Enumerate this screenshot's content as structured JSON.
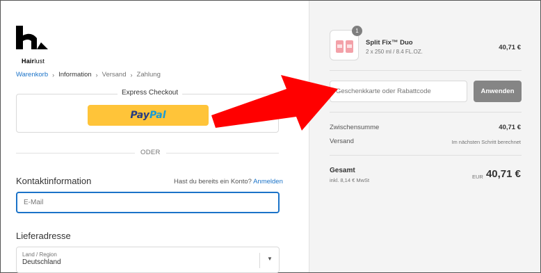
{
  "brand": {
    "logo_bold": "Hair",
    "logo_light": "lust"
  },
  "breadcrumb": [
    {
      "label": "Warenkorb"
    },
    {
      "label": "Information"
    },
    {
      "label": "Versand"
    },
    {
      "label": "Zahlung"
    }
  ],
  "express": {
    "title": "Express Checkout",
    "paypal_pay": "Pay",
    "paypal_pal": "Pal"
  },
  "divider": {
    "label": "ODER"
  },
  "contact": {
    "title": "Kontaktinformation",
    "login_question": "Hast du bereits ein Konto?",
    "login_link": "Anmelden",
    "email_placeholder": "E-Mail"
  },
  "shipping": {
    "title": "Lieferadresse",
    "country_label": "Land / Region",
    "country_value": "Deutschland"
  },
  "summary": {
    "item": {
      "quantity": "1",
      "name": "Split Fix™ Duo",
      "variant": "2 x 250 ml / 8.4 FL.OZ.",
      "price": "40,71 €"
    },
    "discount_placeholder": "Geschenkkarte oder Rabattcode",
    "apply_label": "Anwenden",
    "subtotal_label": "Zwischensumme",
    "subtotal_value": "40,71 €",
    "shipping_label": "Versand",
    "shipping_value": "Im nächsten Schritt berechnet",
    "total_label": "Gesamt",
    "tax_note": "inkl. 8,14 € MwSt",
    "currency": "EUR",
    "total_value": "40,71 €"
  },
  "colors": {
    "link": "#1b73c8",
    "paypal_yellow": "#ffc439",
    "arrow_red": "#ff0000",
    "apply_button": "#858585",
    "summary_bg": "#f4f4f4"
  },
  "icons": [
    "brand-logo-icon",
    "chevron-right-icon",
    "caret-down-icon",
    "red-arrow-annotation"
  ]
}
